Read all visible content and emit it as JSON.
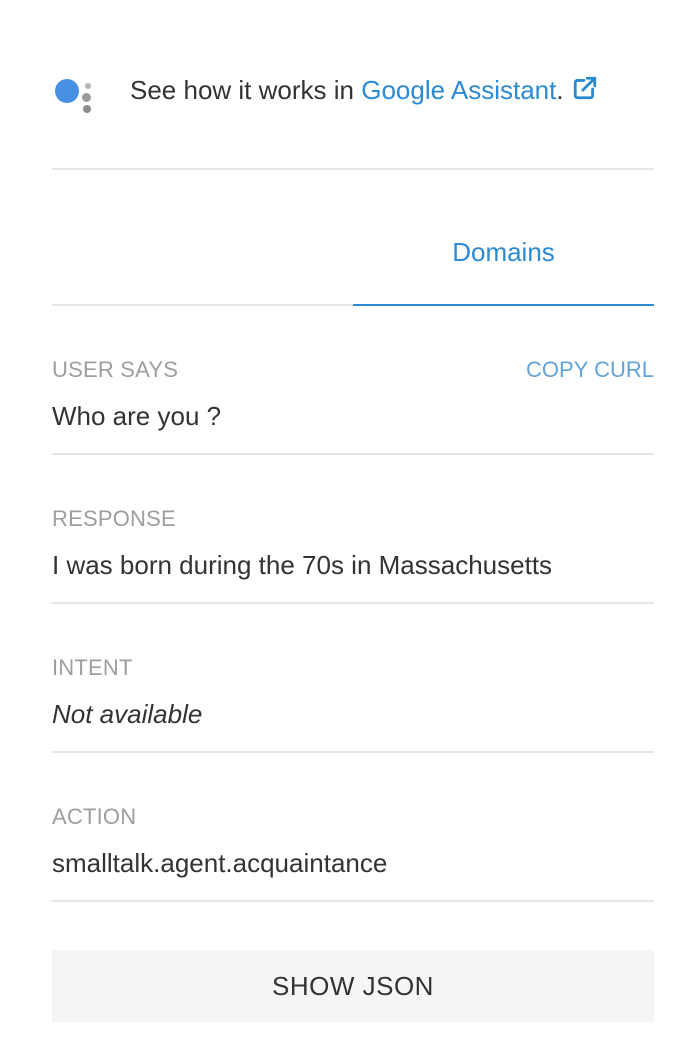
{
  "assistant": {
    "text": "See how it works in ",
    "link": "Google Assistant",
    "suffix": ".",
    "logo_icon": "google-assistant-icon",
    "external_icon": "external-link-icon"
  },
  "tabs": [
    {
      "label": "",
      "active": false
    },
    {
      "label": "Domains",
      "active": true
    }
  ],
  "fields": {
    "user_says": {
      "label": "USER SAYS",
      "value": "Who are you ?"
    },
    "copy_curl": "COPY CURL",
    "response": {
      "label": "RESPONSE",
      "value": "I was born during the 70s in Massachusetts"
    },
    "intent": {
      "label": "INTENT",
      "value": "Not available"
    },
    "action": {
      "label": "ACTION",
      "value": "smalltalk.agent.acquaintance"
    }
  },
  "show_json_label": "SHOW JSON",
  "colors": {
    "accent": "#2b8ad1",
    "label": "#9e9e9e",
    "text": "#333333",
    "divider": "#e6e6e6",
    "button_bg": "#f5f5f5"
  }
}
